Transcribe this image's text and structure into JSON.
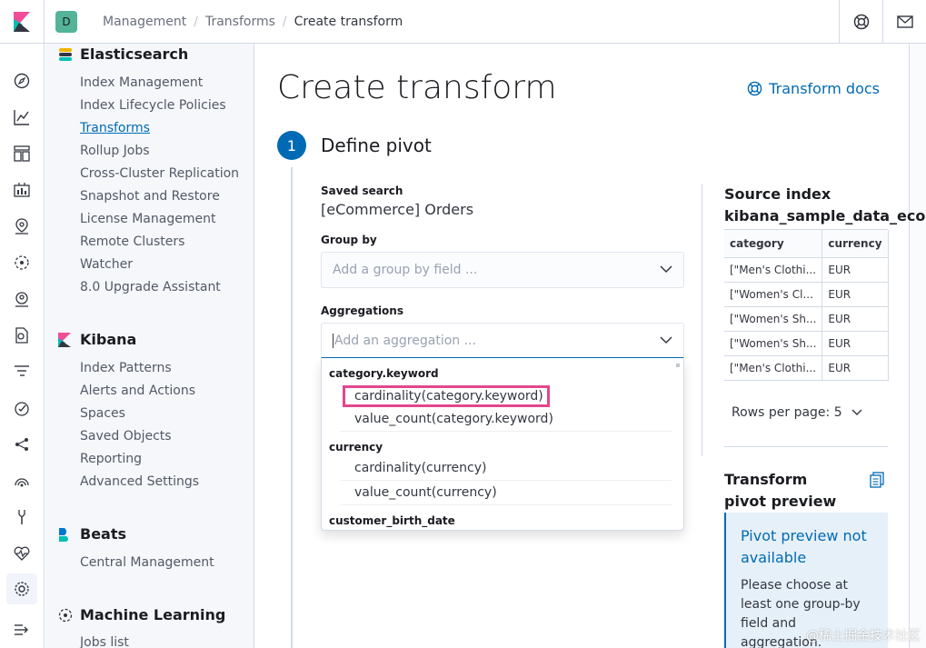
{
  "header": {
    "space_initial": "D",
    "breadcrumbs": [
      "Management",
      "Transforms",
      "Create transform"
    ]
  },
  "sidebar": {
    "sections": [
      {
        "title": "Elasticsearch",
        "items": [
          "Index Management",
          "Index Lifecycle Policies",
          "Transforms",
          "Rollup Jobs",
          "Cross-Cluster Replication",
          "Snapshot and Restore",
          "License Management",
          "Remote Clusters",
          "Watcher",
          "8.0 Upgrade Assistant"
        ]
      },
      {
        "title": "Kibana",
        "items": [
          "Index Patterns",
          "Alerts and Actions",
          "Spaces",
          "Saved Objects",
          "Reporting",
          "Advanced Settings"
        ]
      },
      {
        "title": "Beats",
        "items": [
          "Central Management"
        ]
      },
      {
        "title": "Machine Learning",
        "items": [
          "Jobs list"
        ]
      }
    ],
    "active_item": "Transforms"
  },
  "page": {
    "title": "Create transform",
    "docs_link": "Transform docs",
    "step_number": "1",
    "step_title": "Define pivot",
    "saved_search_label": "Saved search",
    "saved_search_value": "[eCommerce] Orders",
    "group_by_label": "Group by",
    "group_by_placeholder": "Add a group by field ...",
    "aggregations_label": "Aggregations",
    "aggregations_placeholder": "Add an aggregation ..."
  },
  "dropdown": {
    "groups": [
      {
        "name": "category.keyword",
        "options": [
          "cardinality(category.keyword)",
          "value_count(category.keyword)"
        ]
      },
      {
        "name": "currency",
        "options": [
          "cardinality(currency)",
          "value_count(currency)"
        ]
      },
      {
        "name": "customer_birth_date",
        "options": []
      }
    ],
    "highlighted": "cardinality(category.keyword)"
  },
  "source_index": {
    "title": "Source index",
    "name": "kibana_sample_data_ecomme",
    "columns": [
      "category",
      "currency"
    ],
    "rows": [
      [
        "[\"Men's Clothi...",
        "EUR"
      ],
      [
        "[\"Women's Cl...",
        "EUR"
      ],
      [
        "[\"Women's Sh...",
        "EUR"
      ],
      [
        "[\"Women's Sh...",
        "EUR"
      ],
      [
        "[\"Men's Clothi...",
        "EUR"
      ]
    ],
    "rows_per_page": "Rows per page: 5"
  },
  "preview": {
    "title": "Transform pivot preview",
    "callout_title": "Pivot preview not available",
    "callout_text": "Please choose at least one group-by field and aggregation."
  },
  "watermark": "@稀土掘金技术社区",
  "colors": {
    "primary": "#006bb4",
    "highlight_box": "#e2478e",
    "space_avatar": "#54b399"
  }
}
